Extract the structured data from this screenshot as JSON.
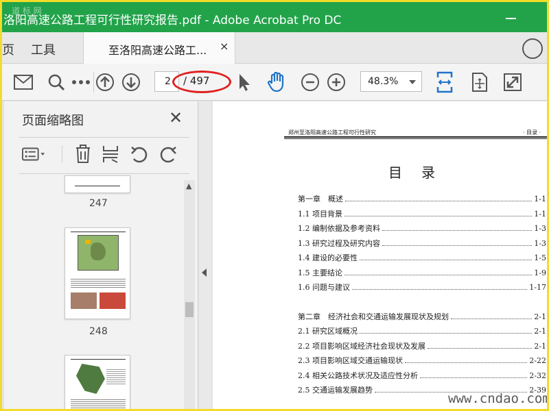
{
  "window": {
    "title": "洛阳高速公路工程可行性研究报告.pdf - Adobe Acrobat Pro DC",
    "watermark_top": "道 标 网"
  },
  "tabs": {
    "home": "页",
    "tools": "工具",
    "document": "至洛阳高速公路工...",
    "close_glyph": "×"
  },
  "toolbar": {
    "page_current": "2",
    "page_total": "/ 497",
    "zoom": "48.3%"
  },
  "thumbnails_panel": {
    "title": "页面缩略图",
    "close_glyph": "✕",
    "pages": [
      {
        "number": "247"
      },
      {
        "number": "248"
      }
    ]
  },
  "document": {
    "header_left": "郑州至洛阳高速公路工程可行性研究",
    "header_right": "· 目录 ·",
    "title": "目录",
    "toc": [
      {
        "label": "第一章　概述",
        "page": "1-1"
      },
      {
        "label": "1.1 项目背景",
        "page": "1-1"
      },
      {
        "label": "1.2 编制依据及参考资料",
        "page": "1-3"
      },
      {
        "label": "1.3 研究过程及研究内容",
        "page": "1-3"
      },
      {
        "label": "1.4 建设的必要性",
        "page": "1-5"
      },
      {
        "label": "1.5 主要结论",
        "page": "1-9"
      },
      {
        "label": "1.6 问题与建议",
        "page": "1-17"
      },
      {
        "label": "第二章　经济社会和交通运输发展现状及规划",
        "page": "2-1"
      },
      {
        "label": "2.1 研究区域概况",
        "page": "2-1"
      },
      {
        "label": "2.2 项目影响区域经济社会现状及发展",
        "page": "2-1"
      },
      {
        "label": "2.3 项目影响区域交通运输现状",
        "page": "2-22"
      },
      {
        "label": "2.4 相关公路技术状况及适应性分析",
        "page": "2-32"
      },
      {
        "label": "2.5 交通运输发展趋势",
        "page": "2-39"
      }
    ]
  },
  "watermark": "www.cndao.com",
  "colors": {
    "titlebar": "#22a34a",
    "frame": "#f2dc2a",
    "annotation": "#e02020",
    "accent_blue": "#1f73c9"
  }
}
